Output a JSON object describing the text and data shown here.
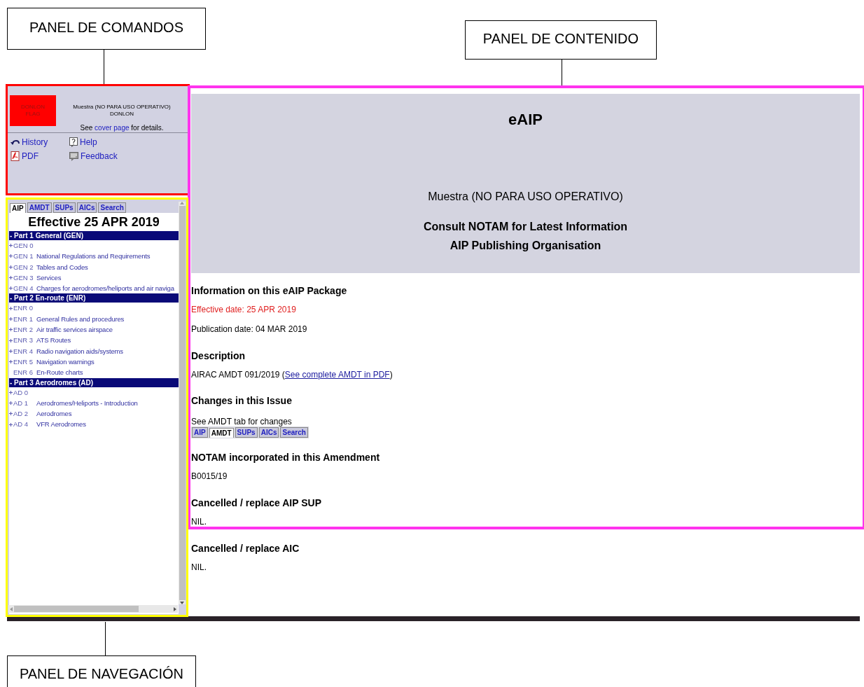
{
  "callouts": [
    {
      "label": "PANEL DE COMANDOS"
    },
    {
      "label": "PANEL DE CONTENIDO"
    },
    {
      "label": "PANEL DE NAVEGACIÓN"
    }
  ],
  "command_panel": {
    "flag": "DONLON FLAG",
    "notice": [
      "Muestra (NO PARA USO OPERATIVO)",
      "DONLON"
    ],
    "details": {
      "before": "See",
      "link": "cover page",
      "after": "for details."
    },
    "links": [
      {
        "label": "History",
        "kind": "history"
      },
      {
        "label": "Help",
        "kind": "help"
      },
      {
        "label": "PDF",
        "kind": "pdf"
      },
      {
        "label": "Feedback",
        "kind": "feedback"
      }
    ]
  },
  "navigation": {
    "tabs": [
      {
        "label": "AIP",
        "selected": true
      },
      {
        "label": "AMDT",
        "selected": false
      },
      {
        "label": "SUPs",
        "selected": false
      },
      {
        "label": "AICs",
        "selected": false
      },
      {
        "label": "Search",
        "selected": false
      }
    ],
    "title": "Effective 25 APR 2019",
    "parts": [
      {
        "number": "- Part 1",
        "title": "General (GEN)",
        "items": [
          {
            "code": "GEN 0",
            "expandable": true
          },
          {
            "code": "GEN 1",
            "title": "National Regulations and Requirements",
            "expandable": true
          },
          {
            "code": "GEN 2",
            "title": "Tables and Codes",
            "expandable": true
          },
          {
            "code": "GEN 3",
            "title": "Services",
            "expandable": true
          },
          {
            "code": "GEN 4",
            "title": "Charges for aerodromes/heliports and air naviga",
            "expandable": true
          }
        ]
      },
      {
        "number": "- Part 2",
        "title": "En-route (ENR)",
        "items": [
          {
            "code": "ENR 0",
            "expandable": true
          },
          {
            "code": "ENR 1",
            "title": "General Rules and procedures",
            "expandable": true
          },
          {
            "code": "ENR 2",
            "title": "Air traffic services airspace",
            "expandable": true
          },
          {
            "code": "ENR 3",
            "title": "ATS Routes",
            "expandable": true
          },
          {
            "code": "ENR 4",
            "title": "Radio navigation aids/systems",
            "expandable": true
          },
          {
            "code": "ENR 5",
            "title": "Navigation warnings",
            "expandable": true
          },
          {
            "code": "ENR 6",
            "title": "En-Route charts",
            "expandable": false
          }
        ]
      },
      {
        "number": "- Part 3",
        "title": "Aerodromes (AD)",
        "items": [
          {
            "code": "AD 0",
            "expandable": true
          },
          {
            "code": "AD 1",
            "title": "Aerodromes/Heliports - Introduction",
            "expandable": true
          },
          {
            "code": "AD 2",
            "title": "Aerodromes",
            "expandable": true
          },
          {
            "code": "AD 4",
            "title": "VFR Aerodromes",
            "expandable": true
          }
        ]
      }
    ]
  },
  "content": {
    "header": {
      "title": "eAIP",
      "subtitle": "Muestra (NO PARA USO OPERATIVO)",
      "lines": [
        "Consult NOTAM for Latest Information",
        "AIP Publishing Organisation"
      ]
    },
    "blocks": [
      {
        "kind": "heading",
        "text": "Information on this eAIP Package"
      },
      {
        "kind": "alert",
        "text": "Effective date: 25 APR 2019"
      },
      {
        "kind": "text",
        "text": "Publication date: 04 MAR 2019"
      },
      {
        "kind": "heading",
        "text": "Description"
      },
      {
        "kind": "link_text",
        "text": "AIRAC AMDT 091/2019 (",
        "link": "See complete AMDT in PDF",
        "after": ")"
      },
      {
        "kind": "heading",
        "text": "Changes in this Issue"
      },
      {
        "kind": "tabs",
        "text": "See AMDT tab for changes",
        "tabs": [
          {
            "label": "AIP",
            "selected": false
          },
          {
            "label": "AMDT",
            "selected": true
          },
          {
            "label": "SUPs",
            "selected": false
          },
          {
            "label": "AICs",
            "selected": false
          },
          {
            "label": "Search",
            "selected": false
          }
        ]
      },
      {
        "kind": "heading",
        "text": "NOTAM incorporated in this Amendment"
      },
      {
        "kind": "text",
        "text": "B0015/19"
      },
      {
        "kind": "heading",
        "text": "Cancelled / replace AIP SUP"
      },
      {
        "kind": "text",
        "text": "NIL."
      },
      {
        "kind": "heading",
        "text": "Cancelled / replace AIC"
      },
      {
        "kind": "text",
        "text": "NIL."
      }
    ]
  }
}
